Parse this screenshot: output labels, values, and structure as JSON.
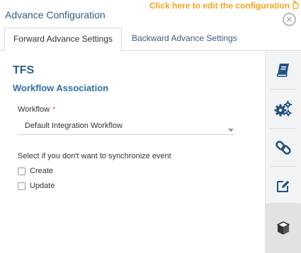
{
  "header": {
    "title": "Advance Configuration",
    "edit_link": "Click here to edit the configuration",
    "close_symbol": "×"
  },
  "tabs": [
    {
      "label": "Forward Advance Settings",
      "active": true
    },
    {
      "label": "Backward Advance Settings",
      "active": false
    }
  ],
  "main": {
    "system_name": "TFS",
    "section_title": "Workflow Association",
    "workflow_label": "Workflow",
    "required_marker": "*",
    "workflow_value": "Default Integration Workflow",
    "sync_label": "Select if you don't want to synchronize event",
    "checkboxes": [
      {
        "label": "Create",
        "checked": false
      },
      {
        "label": "Update",
        "checked": false
      }
    ]
  },
  "side_rail": {
    "icons": [
      "book-icon",
      "gears-icon",
      "link-icon",
      "edit-icon",
      "cube-icon"
    ]
  },
  "colors": {
    "accent": "#2e5d85",
    "rail_icon": "#24527f",
    "edit_link": "#f3a31f",
    "required": "#d9534f"
  }
}
